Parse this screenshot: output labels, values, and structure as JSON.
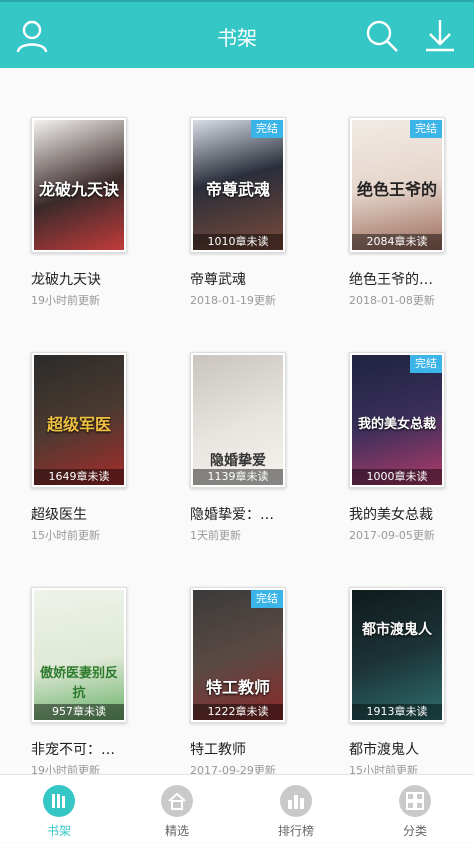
{
  "header": {
    "title": "书架"
  },
  "books": [
    {
      "name": "龙破九天诀",
      "cover_title": "龙破九天诀",
      "updated": "19小时前更新",
      "unread": "",
      "completed": "",
      "colors": [
        "#3a2a2a",
        "#c23b3b"
      ]
    },
    {
      "name": "帝尊武魂",
      "cover_title": "帝尊武魂",
      "updated": "2018-01-19更新",
      "unread": "1010章未读",
      "completed": "完结",
      "colors": [
        "#2a2e3a",
        "#7a4a3a"
      ]
    },
    {
      "name": "绝色王爷的…",
      "cover_title": "绝色王爷的",
      "updated": "2018-01-08更新",
      "unread": "2084章未读",
      "completed": "完结",
      "colors": [
        "#f1ebe5",
        "#9a6b5a"
      ]
    },
    {
      "name": "超级医生",
      "cover_title": "超级军医",
      "updated": "15小时前更新",
      "unread": "1649章未读",
      "completed": "",
      "colors": [
        "#2b2b2b",
        "#a82c2c"
      ]
    },
    {
      "name": "隐婚挚爱：…",
      "cover_title": "隐婚挚爱",
      "updated": "1天前更新",
      "unread": "1139章未读",
      "completed": "",
      "colors": [
        "#e8e4df",
        "#8e8a86"
      ]
    },
    {
      "name": "我的美女总裁",
      "cover_title": "我的美女总裁",
      "updated": "2017-09-05更新",
      "unread": "1000章未读",
      "completed": "完结",
      "colors": [
        "#1e2340",
        "#b13b6a"
      ]
    },
    {
      "name": "非宠不可：…",
      "cover_title": "傲娇医妻别反抗",
      "updated": "19小时前更新",
      "unread": "957章未读",
      "completed": "",
      "colors": [
        "#eef3ea",
        "#6ab06a"
      ]
    },
    {
      "name": "特工教师",
      "cover_title": "特工教师",
      "updated": "2017-09-29更新",
      "unread": "1222章未读",
      "completed": "完结",
      "colors": [
        "#3a3a3a",
        "#8a2a2a"
      ]
    },
    {
      "name": "都市渡鬼人",
      "cover_title": "都市渡鬼人",
      "updated": "15小时前更新",
      "unread": "1913章未读",
      "completed": "",
      "colors": [
        "#0f1a1c",
        "#2f6f6f"
      ]
    }
  ],
  "tabs": [
    {
      "label": "书架",
      "icon": "bookshelf-icon"
    },
    {
      "label": "精选",
      "icon": "home-icon"
    },
    {
      "label": "排行榜",
      "icon": "ranking-icon"
    },
    {
      "label": "分类",
      "icon": "category-icon"
    }
  ],
  "colors": {
    "accent": "#35c6c6",
    "badge": "#3bb4e8"
  }
}
